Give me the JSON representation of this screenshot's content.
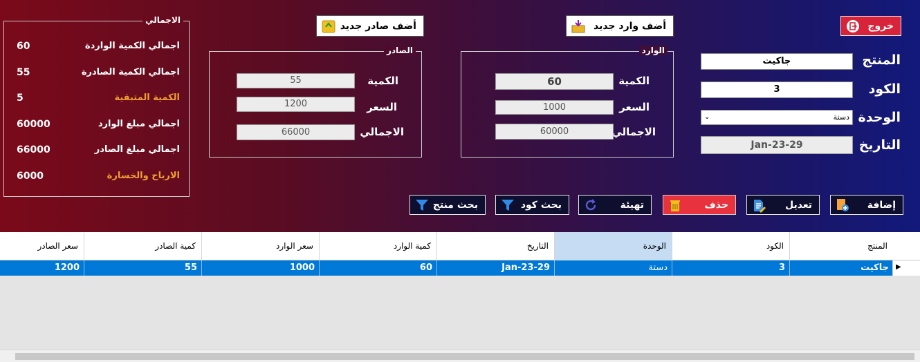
{
  "form": {
    "product_label": "المنتج",
    "product_value": "جاكيت",
    "code_label": "الكود",
    "code_value": "3",
    "unit_label": "الوحدة",
    "unit_value": "دستة",
    "date_label": "التاريخ",
    "date_value": "Jan-23-29"
  },
  "exit_label": "خروج",
  "incoming": {
    "legend": "الوارد",
    "add_label": "أضف وارد جديد",
    "qty_label": "الكمية",
    "qty_value": "60",
    "price_label": "السعر",
    "price_value": "1000",
    "total_label": "الاجمالي",
    "total_value": "60000"
  },
  "outgoing": {
    "legend": "الصادر",
    "add_label": "أضف صادر جديد",
    "qty_label": "الكمية",
    "qty_value": "55",
    "price_label": "السعر",
    "price_value": "1200",
    "total_label": "الاجمالي",
    "total_value": "66000"
  },
  "totals": {
    "legend": "الاجمالي",
    "rows": [
      {
        "label": "اجمالي الكمية الواردة",
        "value": "60"
      },
      {
        "label": "اجمالي الكمية الصادرة",
        "value": "55"
      },
      {
        "label": "الكمية المتبقية",
        "value": "5"
      },
      {
        "label": "اجمالي مبلغ الوارد",
        "value": "60000"
      },
      {
        "label": "اجمالي مبلغ الصادر",
        "value": "66000"
      },
      {
        "label": "الارباح والخسارة",
        "value": "6000"
      }
    ]
  },
  "actions": {
    "add": "إضافة",
    "edit": "تعديل",
    "delete": "حذف",
    "reset": "تهيئة",
    "search_code": "بحث كود",
    "search_product": "بحث منتج"
  },
  "grid": {
    "columns": [
      "المنتج",
      "الكود",
      "الوحدة",
      "التاريخ",
      "كمية الوارد",
      "سعر الوارد",
      "كمية الصادر",
      "سعر الصادر"
    ],
    "rows": [
      [
        "جاكيت",
        "3",
        "دستة",
        "Jan-23-29",
        "60",
        "1000",
        "55",
        "1200"
      ]
    ]
  },
  "colors": {
    "orange_label": "#f0a030",
    "selection": "#0078d7",
    "delete_button": "#e8333f"
  }
}
